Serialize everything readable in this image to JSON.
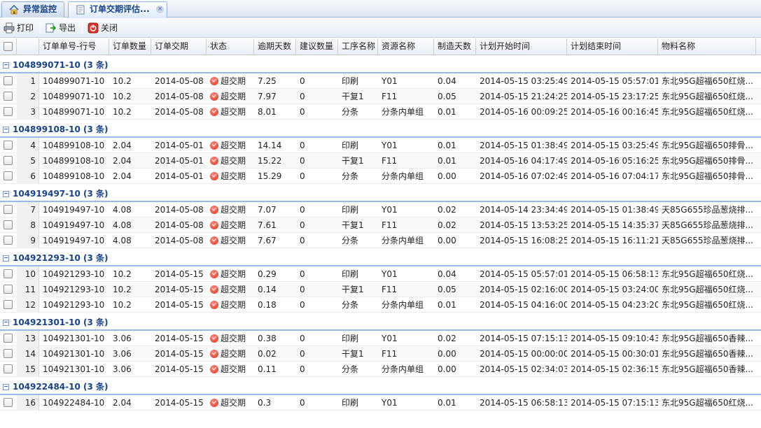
{
  "tabs": [
    {
      "label": "异常监控",
      "icon": "home-icon"
    },
    {
      "label": "订单交期评估...",
      "icon": "document-icon",
      "active": true
    }
  ],
  "toolbar": {
    "print_label": "打印",
    "export_label": "导出",
    "close_label": "关闭"
  },
  "columns": [
    "订单单号-行号",
    "订单数量",
    "订单交期",
    "状态",
    "逾期天数",
    "建议数量",
    "工序名称",
    "资源名称",
    "制造天数",
    "计划开始时间",
    "计划结束时间",
    "物料名称"
  ],
  "groups": [
    {
      "title": "104899071-10 (3 条)",
      "rows": [
        {
          "num": "1",
          "order": "104899071-10",
          "qty": "10.2",
          "due": "2014-05-08",
          "status": "超交期",
          "overdue": "7.25",
          "suggest": "0",
          "process": "印刷",
          "resource": "Y01",
          "mfg_days": "0.04",
          "start": "2014-05-15 03:25:49",
          "end": "2014-05-15 05:57:01",
          "material": "东北95G超福650红烧..."
        },
        {
          "num": "2",
          "order": "104899071-10",
          "qty": "10.2",
          "due": "2014-05-08",
          "status": "超交期",
          "overdue": "7.97",
          "suggest": "0",
          "process": "干复1",
          "resource": "F11",
          "mfg_days": "0.05",
          "start": "2014-05-15 21:24:25",
          "end": "2014-05-15 23:17:25",
          "material": "东北95G超福650红烧..."
        },
        {
          "num": "3",
          "order": "104899071-10",
          "qty": "10.2",
          "due": "2014-05-08",
          "status": "超交期",
          "overdue": "8.01",
          "suggest": "0",
          "process": "分条",
          "resource": "分条内单组",
          "mfg_days": "0.01",
          "start": "2014-05-16 00:09:25",
          "end": "2014-05-16 00:16:45",
          "material": "东北95G超福650红烧..."
        }
      ]
    },
    {
      "title": "104899108-10 (3 条)",
      "rows": [
        {
          "num": "4",
          "order": "104899108-10",
          "qty": "2.04",
          "due": "2014-05-01",
          "status": "超交期",
          "overdue": "14.14",
          "suggest": "0",
          "process": "印刷",
          "resource": "Y01",
          "mfg_days": "0.01",
          "start": "2014-05-15 01:38:49",
          "end": "2014-05-15 03:25:49",
          "material": "东北95G超福650排骨..."
        },
        {
          "num": "5",
          "order": "104899108-10",
          "qty": "2.04",
          "due": "2014-05-01",
          "status": "超交期",
          "overdue": "15.22",
          "suggest": "0",
          "process": "干复1",
          "resource": "F11",
          "mfg_days": "0.01",
          "start": "2014-05-16 04:17:49",
          "end": "2014-05-16 05:16:25",
          "material": "东北95G超福650排骨..."
        },
        {
          "num": "6",
          "order": "104899108-10",
          "qty": "2.04",
          "due": "2014-05-01",
          "status": "超交期",
          "overdue": "15.29",
          "suggest": "0",
          "process": "分条",
          "resource": "分条内单组",
          "mfg_days": "0.00",
          "start": "2014-05-16 07:02:49",
          "end": "2014-05-16 07:04:17",
          "material": "东北95G超福650排骨..."
        }
      ]
    },
    {
      "title": "104919497-10 (3 条)",
      "rows": [
        {
          "num": "7",
          "order": "104919497-10",
          "qty": "4.08",
          "due": "2014-05-08",
          "status": "超交期",
          "overdue": "7.07",
          "suggest": "0",
          "process": "印刷",
          "resource": "Y01",
          "mfg_days": "0.02",
          "start": "2014-05-14 23:34:49",
          "end": "2014-05-15 01:38:49",
          "material": "天85G655珍品葱烧排..."
        },
        {
          "num": "8",
          "order": "104919497-10",
          "qty": "4.08",
          "due": "2014-05-08",
          "status": "超交期",
          "overdue": "7.61",
          "suggest": "0",
          "process": "干复1",
          "resource": "F11",
          "mfg_days": "0.02",
          "start": "2014-05-15 13:53:25",
          "end": "2014-05-15 14:35:37",
          "material": "天85G655珍品葱烧排..."
        },
        {
          "num": "9",
          "order": "104919497-10",
          "qty": "4.08",
          "due": "2014-05-08",
          "status": "超交期",
          "overdue": "7.67",
          "suggest": "0",
          "process": "分条",
          "resource": "分条内单组",
          "mfg_days": "0.00",
          "start": "2014-05-15 16:08:25",
          "end": "2014-05-15 16:11:21",
          "material": "天85G655珍品葱烧排..."
        }
      ]
    },
    {
      "title": "104921293-10 (3 条)",
      "rows": [
        {
          "num": "10",
          "order": "104921293-10",
          "qty": "10.2",
          "due": "2014-05-15",
          "status": "超交期",
          "overdue": "0.29",
          "suggest": "0",
          "process": "印刷",
          "resource": "Y01",
          "mfg_days": "0.04",
          "start": "2014-05-15 05:57:01",
          "end": "2014-05-15 06:58:13",
          "material": "东北95G超福650红烧..."
        },
        {
          "num": "11",
          "order": "104921293-10",
          "qty": "10.2",
          "due": "2014-05-15",
          "status": "超交期",
          "overdue": "0.14",
          "suggest": "0",
          "process": "干复1",
          "resource": "F11",
          "mfg_days": "0.05",
          "start": "2014-05-15 02:16:00",
          "end": "2014-05-15 03:24:00",
          "material": "东北95G超福650红烧..."
        },
        {
          "num": "12",
          "order": "104921293-10",
          "qty": "10.2",
          "due": "2014-05-15",
          "status": "超交期",
          "overdue": "0.18",
          "suggest": "0",
          "process": "分条",
          "resource": "分条内单组",
          "mfg_days": "0.01",
          "start": "2014-05-15 04:16:00",
          "end": "2014-05-15 04:23:20",
          "material": "东北95G超福650红烧..."
        }
      ]
    },
    {
      "title": "104921301-10 (3 条)",
      "rows": [
        {
          "num": "13",
          "order": "104921301-10",
          "qty": "3.06",
          "due": "2014-05-15",
          "status": "超交期",
          "overdue": "0.38",
          "suggest": "0",
          "process": "印刷",
          "resource": "Y01",
          "mfg_days": "0.02",
          "start": "2014-05-15 07:15:13",
          "end": "2014-05-15 09:10:43",
          "material": "东北95G超福650香辣..."
        },
        {
          "num": "14",
          "order": "104921301-10",
          "qty": "3.06",
          "due": "2014-05-15",
          "status": "超交期",
          "overdue": "0.02",
          "suggest": "0",
          "process": "干复1",
          "resource": "F11",
          "mfg_days": "0.00",
          "start": "2014-05-15 00:00:00",
          "end": "2014-05-15 00:30:01",
          "material": "东北95G超福650香辣..."
        },
        {
          "num": "15",
          "order": "104921301-10",
          "qty": "3.06",
          "due": "2014-05-15",
          "status": "超交期",
          "overdue": "0.11",
          "suggest": "0",
          "process": "分条",
          "resource": "分条内单组",
          "mfg_days": "0.00",
          "start": "2014-05-15 02:34:03",
          "end": "2014-05-15 02:36:15",
          "material": "东北95G超福650香辣..."
        }
      ]
    },
    {
      "title": "104922484-10 (3 条)",
      "rows": [
        {
          "num": "16",
          "order": "104922484-10",
          "qty": "2.04",
          "due": "2014-05-15",
          "status": "超交期",
          "overdue": "0.3",
          "suggest": "0",
          "process": "印刷",
          "resource": "Y01",
          "mfg_days": "0.01",
          "start": "2014-05-15 06:58:13",
          "end": "2014-05-15 07:15:13",
          "material": "东北95G超福650红烧..."
        }
      ]
    }
  ]
}
